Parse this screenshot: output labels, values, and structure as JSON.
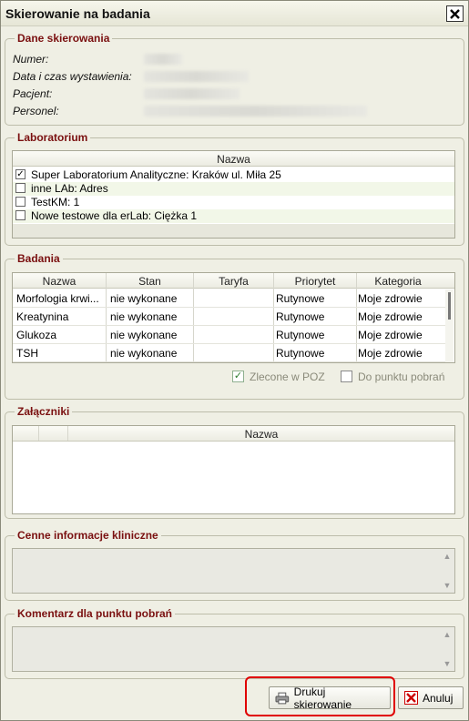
{
  "window": {
    "title": "Skierowanie na badania"
  },
  "dane": {
    "legend": "Dane skierowania",
    "fields": [
      {
        "label": "Numer:"
      },
      {
        "label": "Data i czas wystawienia:"
      },
      {
        "label": "Pacjent:"
      },
      {
        "label": "Personel:"
      }
    ]
  },
  "laboratorium": {
    "legend": "Laboratorium",
    "column": "Nazwa",
    "items": [
      {
        "label": "Super Laboratorium Analityczne: Kraków ul. Miła 25",
        "checked": true,
        "mark": "✓"
      },
      {
        "label": "inne LAb: Adres",
        "checked": false,
        "mark": ""
      },
      {
        "label": "TestKM: 1",
        "checked": false,
        "mark": ""
      },
      {
        "label": "Nowe testowe dla erLab: Ciężka 1",
        "checked": false,
        "mark": ""
      }
    ]
  },
  "badania": {
    "legend": "Badania",
    "columns": [
      "Nazwa",
      "Stan",
      "Taryfa",
      "Priorytet",
      "Kategoria"
    ],
    "rows": [
      {
        "nazwa": "Morfologia krwi...",
        "stan": "nie wykonane",
        "taryfa": "",
        "priorytet": "Rutynowe",
        "kategoria": "Moje zdrowie"
      },
      {
        "nazwa": "Kreatynina",
        "stan": "nie wykonane",
        "taryfa": "",
        "priorytet": "Rutynowe",
        "kategoria": "Moje zdrowie"
      },
      {
        "nazwa": "Glukoza",
        "stan": "nie wykonane",
        "taryfa": "",
        "priorytet": "Rutynowe",
        "kategoria": "Moje zdrowie"
      },
      {
        "nazwa": "TSH",
        "stan": "nie wykonane",
        "taryfa": "",
        "priorytet": "Rutynowe",
        "kategoria": "Moje zdrowie"
      }
    ],
    "zlecone": {
      "label": "Zlecone w POZ",
      "checked": true,
      "mark": "✓"
    },
    "dopunktu": {
      "label": "Do punktu pobrań",
      "checked": false,
      "mark": ""
    }
  },
  "zalaczniki": {
    "legend": "Załączniki",
    "column": "Nazwa"
  },
  "cenne": {
    "legend": "Cenne informacje kliniczne",
    "value": ""
  },
  "komentarz": {
    "legend": "Komentarz dla punktu pobrań",
    "value": ""
  },
  "buttons": {
    "print": "Drukuj skierowanie",
    "cancel": "Anuluj"
  },
  "scroll": {
    "up": "▲",
    "down": "▼"
  },
  "icons": {
    "close": "close-icon",
    "printer": "printer-icon",
    "cancel": "cancel-x-icon"
  },
  "colors": {
    "legend": "#7a1010",
    "highlight": "#e00000",
    "checked": "#2b7a2b"
  }
}
